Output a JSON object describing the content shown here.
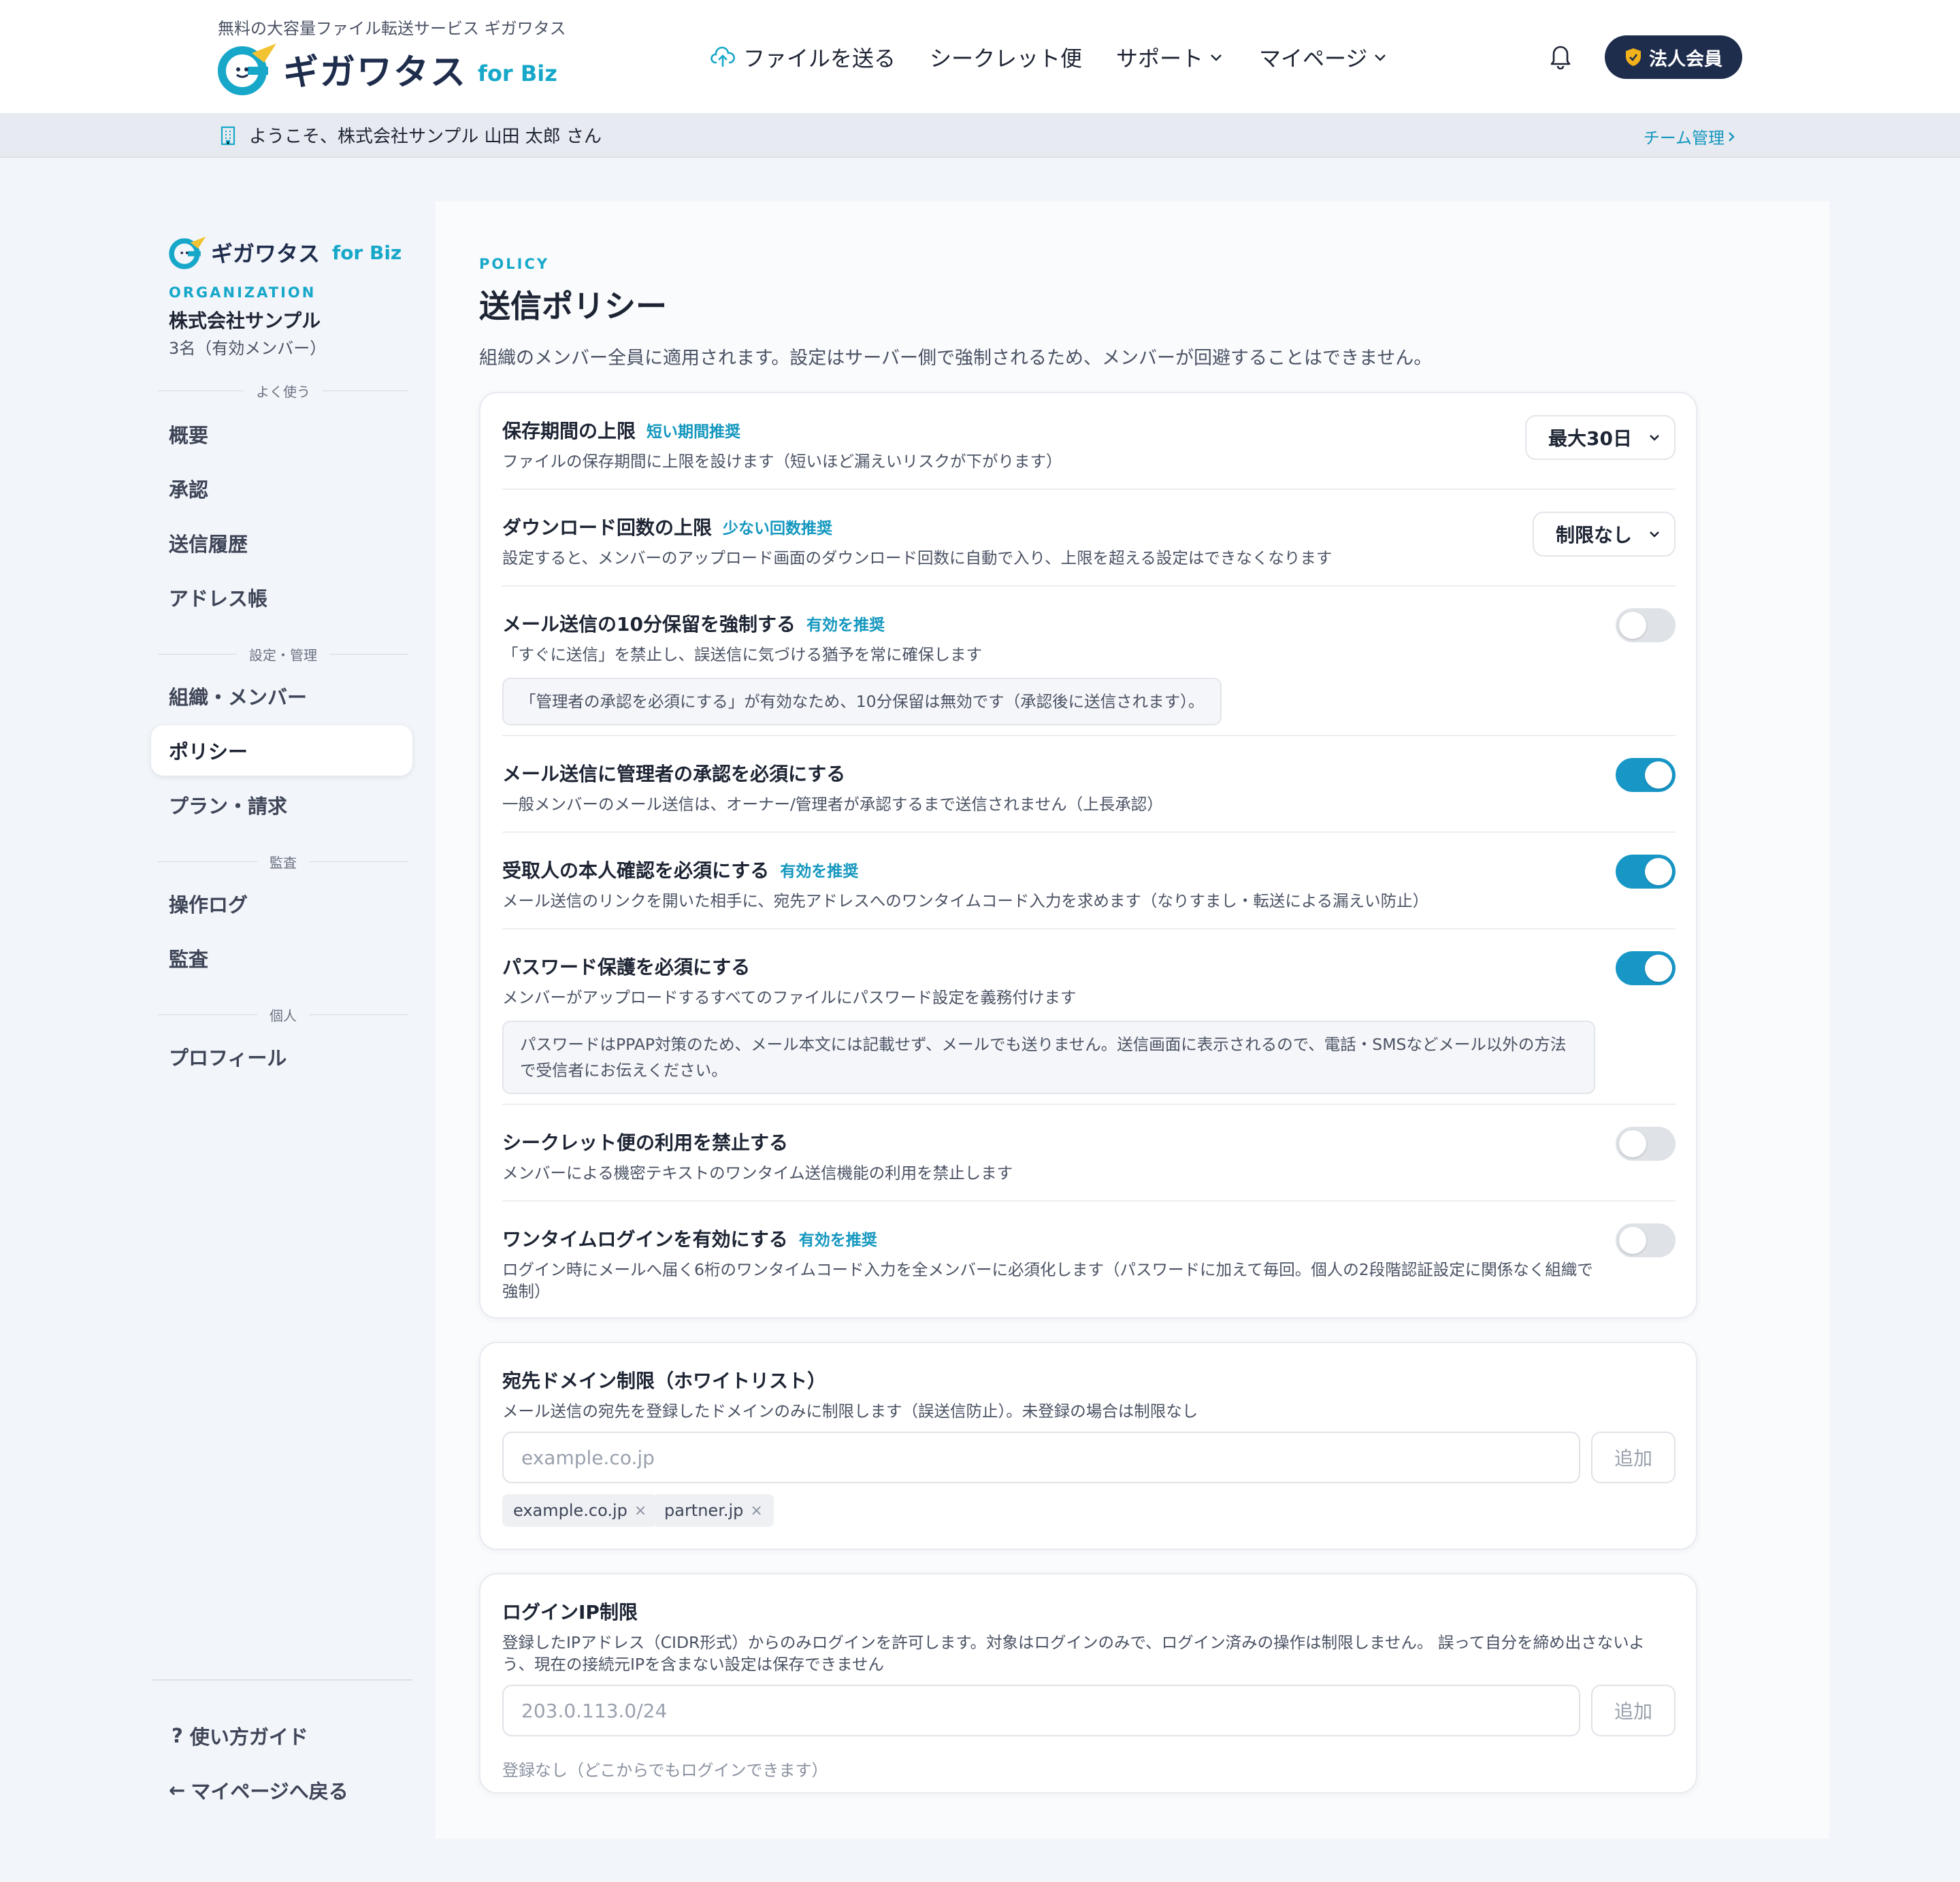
{
  "header": {
    "tagline": "無料の大容量ファイル転送サービス ギガワタス",
    "logo_text": "ギガワタス",
    "logo_biz": "for Biz",
    "nav": [
      {
        "label": "ファイルを送る",
        "icon": "cloud-upload-icon"
      },
      {
        "label": "シークレット便"
      },
      {
        "label": "サポート",
        "icon": "chevron-down-icon"
      },
      {
        "label": "マイページ",
        "icon": "chevron-down-icon"
      }
    ],
    "corp_badge": "法人会員"
  },
  "welcome": {
    "text": "ようこそ、株式会社サンプル 山田 太郎 さん",
    "team_link": "チーム管理"
  },
  "sidebar": {
    "logo_text": "ギガワタス",
    "logo_biz": "for Biz",
    "org_label": "ORGANIZATION",
    "org_name": "株式会社サンプル",
    "org_count": "3名（有効メンバー）",
    "sections": [
      {
        "label": "よく使う",
        "items": [
          "概要",
          "承認",
          "送信履歴",
          "アドレス帳"
        ]
      },
      {
        "label": "設定・管理",
        "items": [
          "組織・メンバー",
          "ポリシー",
          "プラン・請求"
        ]
      },
      {
        "label": "監査",
        "items": [
          "操作ログ",
          "監査"
        ]
      },
      {
        "label": "個人",
        "items": [
          "プロフィール"
        ]
      }
    ],
    "active_item": "ポリシー",
    "guide": "使い方ガイド",
    "back": "マイページへ戻る"
  },
  "main": {
    "kicker": "POLICY",
    "title": "送信ポリシー",
    "description": "組織のメンバー全員に適用されます。設定はサーバー側で強制されるため、メンバーが回避することはできません。",
    "settings": [
      {
        "title": "保存期間の上限",
        "rec": "短い期間推奨",
        "sub": "ファイルの保存期間に上限を設けます（短いほど漏えいリスクが下がります）",
        "select": "最大30日"
      },
      {
        "title": "ダウンロード回数の上限",
        "rec": "少ない回数推奨",
        "sub": "設定すると、メンバーのアップロード画面のダウンロード回数に自動で入り、上限を超える設定はできなくなります",
        "select": "制限なし"
      },
      {
        "title": "メール送信の10分保留を強制する",
        "rec": "有効を推奨",
        "sub": "「すぐに送信」を禁止し、誤送信に気づける猶予を常に確保します",
        "note": "「管理者の承認を必須にする」が有効なため、10分保留は無効です（承認後に送信されます）。",
        "toggle": false
      },
      {
        "title": "メール送信に管理者の承認を必須にする",
        "sub": "一般メンバーのメール送信は、オーナー/管理者が承認するまで送信されません（上長承認）",
        "toggle": true
      },
      {
        "title": "受取人の本人確認を必須にする",
        "rec": "有効を推奨",
        "sub": "メール送信のリンクを開いた相手に、宛先アドレスへのワンタイムコード入力を求めます（なりすまし・転送による漏えい防止）",
        "toggle": true
      },
      {
        "title": "パスワード保護を必須にする",
        "sub": "メンバーがアップロードするすべてのファイルにパスワード設定を義務付けます",
        "note": "パスワードはPPAP対策のため、メール本文には記載せず、メールでも送りません。送信画面に表示されるので、電話・SMSなどメール以外の方法で受信者にお伝えください。",
        "toggle": true
      },
      {
        "title": "シークレット便の利用を禁止する",
        "sub": "メンバーによる機密テキストのワンタイム送信機能の利用を禁止します",
        "toggle": false
      },
      {
        "title": "ワンタイムログインを有効にする",
        "rec": "有効を推奨",
        "sub": "ログイン時にメールへ届く6桁のワンタイムコード入力を全メンバーに必須化します（パスワードに加えて毎回。個人の2段階認証設定に関係なく組織で強制）",
        "toggle": false
      }
    ],
    "domain": {
      "title": "宛先ドメイン制限（ホワイトリスト）",
      "sub": "メール送信の宛先を登録したドメインのみに制限します（誤送信防止）。未登録の場合は制限なし",
      "placeholder": "example.co.jp",
      "add": "追加",
      "chips": [
        "example.co.jp",
        "partner.jp"
      ]
    },
    "ip": {
      "title": "ログインIP制限",
      "sub": "登録したIPアドレス（CIDR形式）からのみログインを許可します。対象はログインのみで、ログイン済みの操作は制限しません。 誤って自分を締め出さないよう、現在の接続元IPを含まない設定は保存できません",
      "placeholder": "203.0.113.0/24",
      "add": "追加",
      "empty": "登録なし（どこからでもログインできます）"
    }
  },
  "colors": {
    "accent": "#17a8c9",
    "navy": "#1f2d4d",
    "toggle_on": "#1897c7"
  }
}
